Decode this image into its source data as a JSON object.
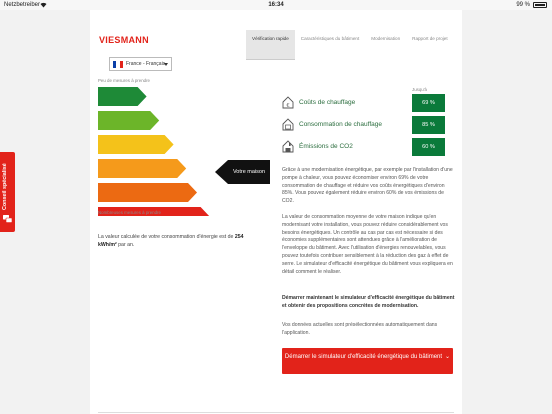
{
  "status": {
    "carrier": "Netzbetreiber",
    "time": "16:34",
    "battery": "99 %"
  },
  "brand": "VIESMANN",
  "nav": [
    {
      "label": "Vérification rapide",
      "active": true
    },
    {
      "label": "Caractéristiques du bâtiment",
      "active": false
    },
    {
      "label": "Modernisation",
      "active": false
    },
    {
      "label": "Rapport de projet",
      "active": false
    }
  ],
  "language": {
    "selected": "France - Français",
    "flag_colors": [
      "#0b3fa8",
      "#ffffff",
      "#e2231a"
    ]
  },
  "scale": {
    "top_label": "Peu de mesures à prendre",
    "bottom_label": "Nombreuses mesures à prendre",
    "bars": [
      {
        "color": "#1e8a37",
        "length": 0.27
      },
      {
        "color": "#6cb529",
        "length": 0.34
      },
      {
        "color": "#f4c21a",
        "length": 0.42
      },
      {
        "color": "#f59a1b",
        "length": 0.49
      },
      {
        "color": "#ec6a12",
        "length": 0.55
      },
      {
        "color": "#e2231a",
        "length": 0.62
      }
    ],
    "marker_label": "Votre maison",
    "marker_bar_index": 4
  },
  "consumption": {
    "text_before": "La valeur calculée de votre consommation d'énergie est de ",
    "value": "254 kWh/m²",
    "text_after": " par an."
  },
  "metrics": {
    "header": "Jusqu'à",
    "items": [
      {
        "label": "Coûts de chauffage",
        "value": "69 %",
        "icon": "euro-house-icon"
      },
      {
        "label": "Consommation de chauffage",
        "value": "85 %",
        "icon": "heater-house-icon"
      },
      {
        "label": "Émissions de CO2",
        "value": "60 %",
        "icon": "factory-house-icon"
      }
    ]
  },
  "paragraphs": [
    "Grâce à une modernisation énergétique, par exemple par l'installation d'une pompe à chaleur, vous pouvez économiser environ 69% de votre consommation de chauffage et réduire vos coûts énergétiques d'environ 85%. Vous pouvez également réduire environ 60% de vos émissions de CO2.",
    "La valeur de consommation moyenne de votre maison indique qu'en modernisant votre installation, vous pouvez réduire considérablement vos besoins énergétiques. Un contrôle au cas par cas est nécessaire si des économies supplémentaires sont attendues grâce à l'amélioration de l'enveloppe du bâtiment. Avec l'utilisation d'énergies renouvelables, vous pouvez toutefois contribuer sensiblement à la réduction des gaz à effet de serre. Le simulateur d'efficacité énergétique du bâtiment vous expliquera en détail comment le réaliser.",
    "Démarrer maintenant le simulateur d'efficacité énergétique du bâtiment et obtenir des propositions concrètes de modernisation.",
    "Vos données actuelles sont présélectionnées automatiquement dans l'application."
  ],
  "cta": {
    "label": "Démarrer le simulateur d'efficacité énergétique du bâtiment"
  },
  "side_tab": {
    "label": "Conseil spécialisé"
  },
  "colors": {
    "accent": "#e2231a",
    "metric_green": "#0a7a3a",
    "metric_text": "#2c6e3f"
  }
}
